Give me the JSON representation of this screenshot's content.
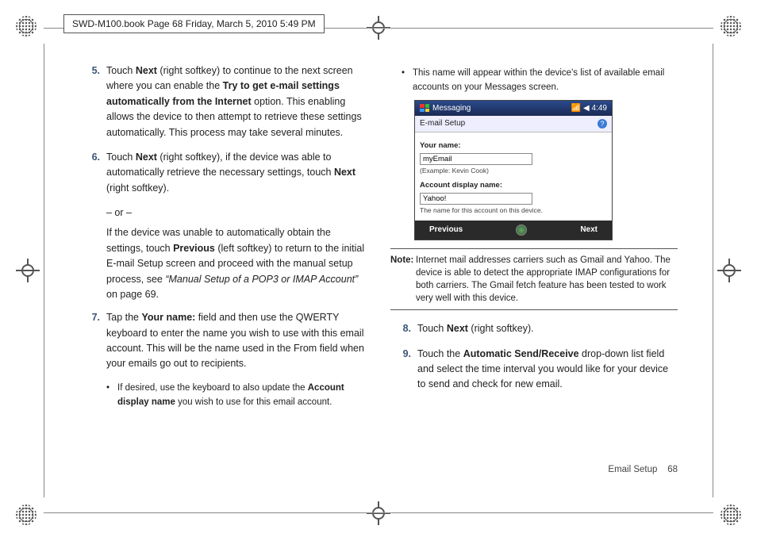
{
  "header_stamp": "SWD-M100.book  Page 68  Friday, March 5, 2010  5:49 PM",
  "steps": {
    "s5": {
      "num": "5.",
      "pre": "Touch ",
      "b1": "Next",
      "mid1": " (right softkey) to continue to the next screen where you can enable the ",
      "b2": "Try to get e-mail settings automatically from the Internet",
      "post": " option. This enabling allows the device to then attempt to retrieve these settings automatically. This process may take several minutes."
    },
    "s6": {
      "num": "6.",
      "pre": "Touch ",
      "b1": "Next",
      "mid1": " (right softkey), if the device was able to automatically retrieve the necessary settings, touch ",
      "b2": "Next",
      "post": " (right softkey).",
      "or": "– or –",
      "alt_pre": "If the device was unable to automatically obtain the settings, touch ",
      "alt_b": "Previous",
      "alt_mid": " (left softkey) to return to the initial E-mail Setup screen and proceed with the manual setup process, see ",
      "alt_ref": "“Manual Setup of a POP3 or IMAP Account”",
      "alt_post": " on page 69."
    },
    "s7": {
      "num": "7.",
      "pre": "Tap the ",
      "b1": "Your name:",
      "post": " field and then use the QWERTY keyboard to enter the name you wish to use with this email account. This will be the name used in the From field when your emails go out to recipients.",
      "bullet_pre": "If desired, use the keyboard to also update the ",
      "bullet_b": "Account display name",
      "bullet_post": " you wish to use for this email account."
    },
    "right_bullet": "This name will appear within the device's list of available email accounts on your Messages screen.",
    "note": {
      "label": "Note:",
      "body": "Internet mail addresses carriers such as Gmail and Yahoo. The device is able to detect the appropriate IMAP configurations for both carriers. The Gmail fetch feature has been tested to work very well with this device."
    },
    "s8": {
      "num": "8.",
      "pre": "Touch ",
      "b1": "Next",
      "post": " (right softkey)."
    },
    "s9": {
      "num": "9.",
      "pre": "Touch the ",
      "b1": "Automatic Send/Receive",
      "post": " drop-down list field and select the time interval you would like for your device to send and check for new email."
    }
  },
  "device": {
    "title": "Messaging",
    "clock": "4:49",
    "subtitle": "E-mail Setup",
    "your_name_label": "Your name:",
    "your_name_value": "myEmail",
    "your_name_hint": "(Example: Kevin Cook)",
    "display_label": "Account display name:",
    "display_value": "Yahoo!",
    "display_hint": "The name for this account on this device.",
    "sk_prev": "Previous",
    "sk_next": "Next"
  },
  "footer": {
    "section": "Email Setup",
    "page": "68"
  }
}
